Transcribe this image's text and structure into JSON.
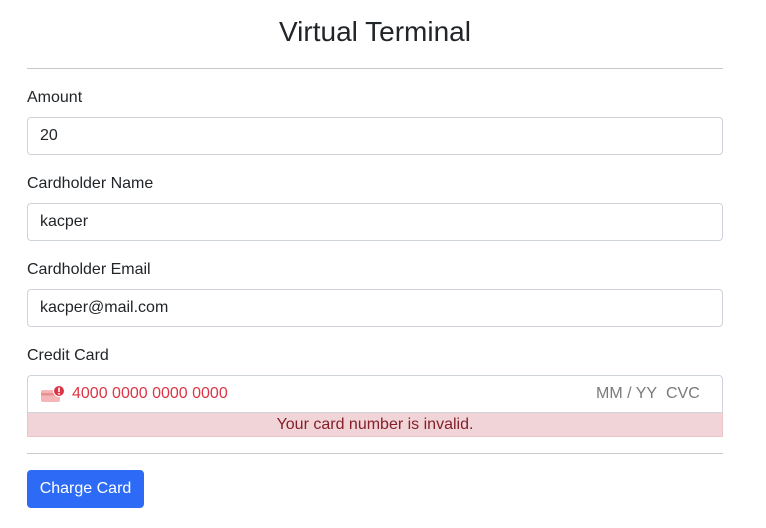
{
  "page": {
    "title": "Virtual Terminal"
  },
  "form": {
    "amount": {
      "label": "Amount",
      "value": "20"
    },
    "name": {
      "label": "Cardholder Name",
      "value": "kacper"
    },
    "email": {
      "label": "Cardholder Email",
      "value": "kacper@mail.com"
    },
    "card": {
      "label": "Credit Card",
      "number": "4000 0000 0000 0000",
      "expiry_placeholder": "MM / YY",
      "cvc_placeholder": "CVC",
      "error": "Your card number is invalid.",
      "icon": "card-error-icon"
    },
    "submit_label": "Charge Card"
  },
  "colors": {
    "primary": "#2d6bf6",
    "error_text": "#dc3545",
    "error_bg": "#f1d4d7"
  }
}
